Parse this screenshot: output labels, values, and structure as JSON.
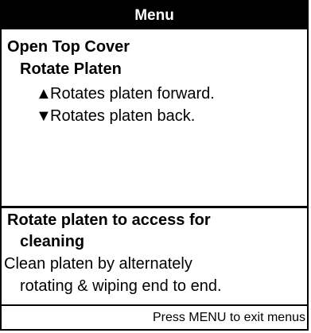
{
  "title": "Menu",
  "menu": {
    "heading": "Open Top Cover",
    "subheading": "Rotate Platen",
    "options": [
      {
        "icon": "up-triangle-icon",
        "symbol": "▲",
        "text": "Rotates platen forward."
      },
      {
        "icon": "down-triangle-icon",
        "symbol": "▼",
        "text": "Rotates platen back."
      }
    ]
  },
  "info": {
    "heading_line1": "Rotate platen to access for",
    "heading_line2": "cleaning",
    "body_line1": "Clean platen by alternately",
    "body_line2": "rotating & wiping end to end."
  },
  "footer": {
    "hint": "Press MENU to exit menus"
  }
}
